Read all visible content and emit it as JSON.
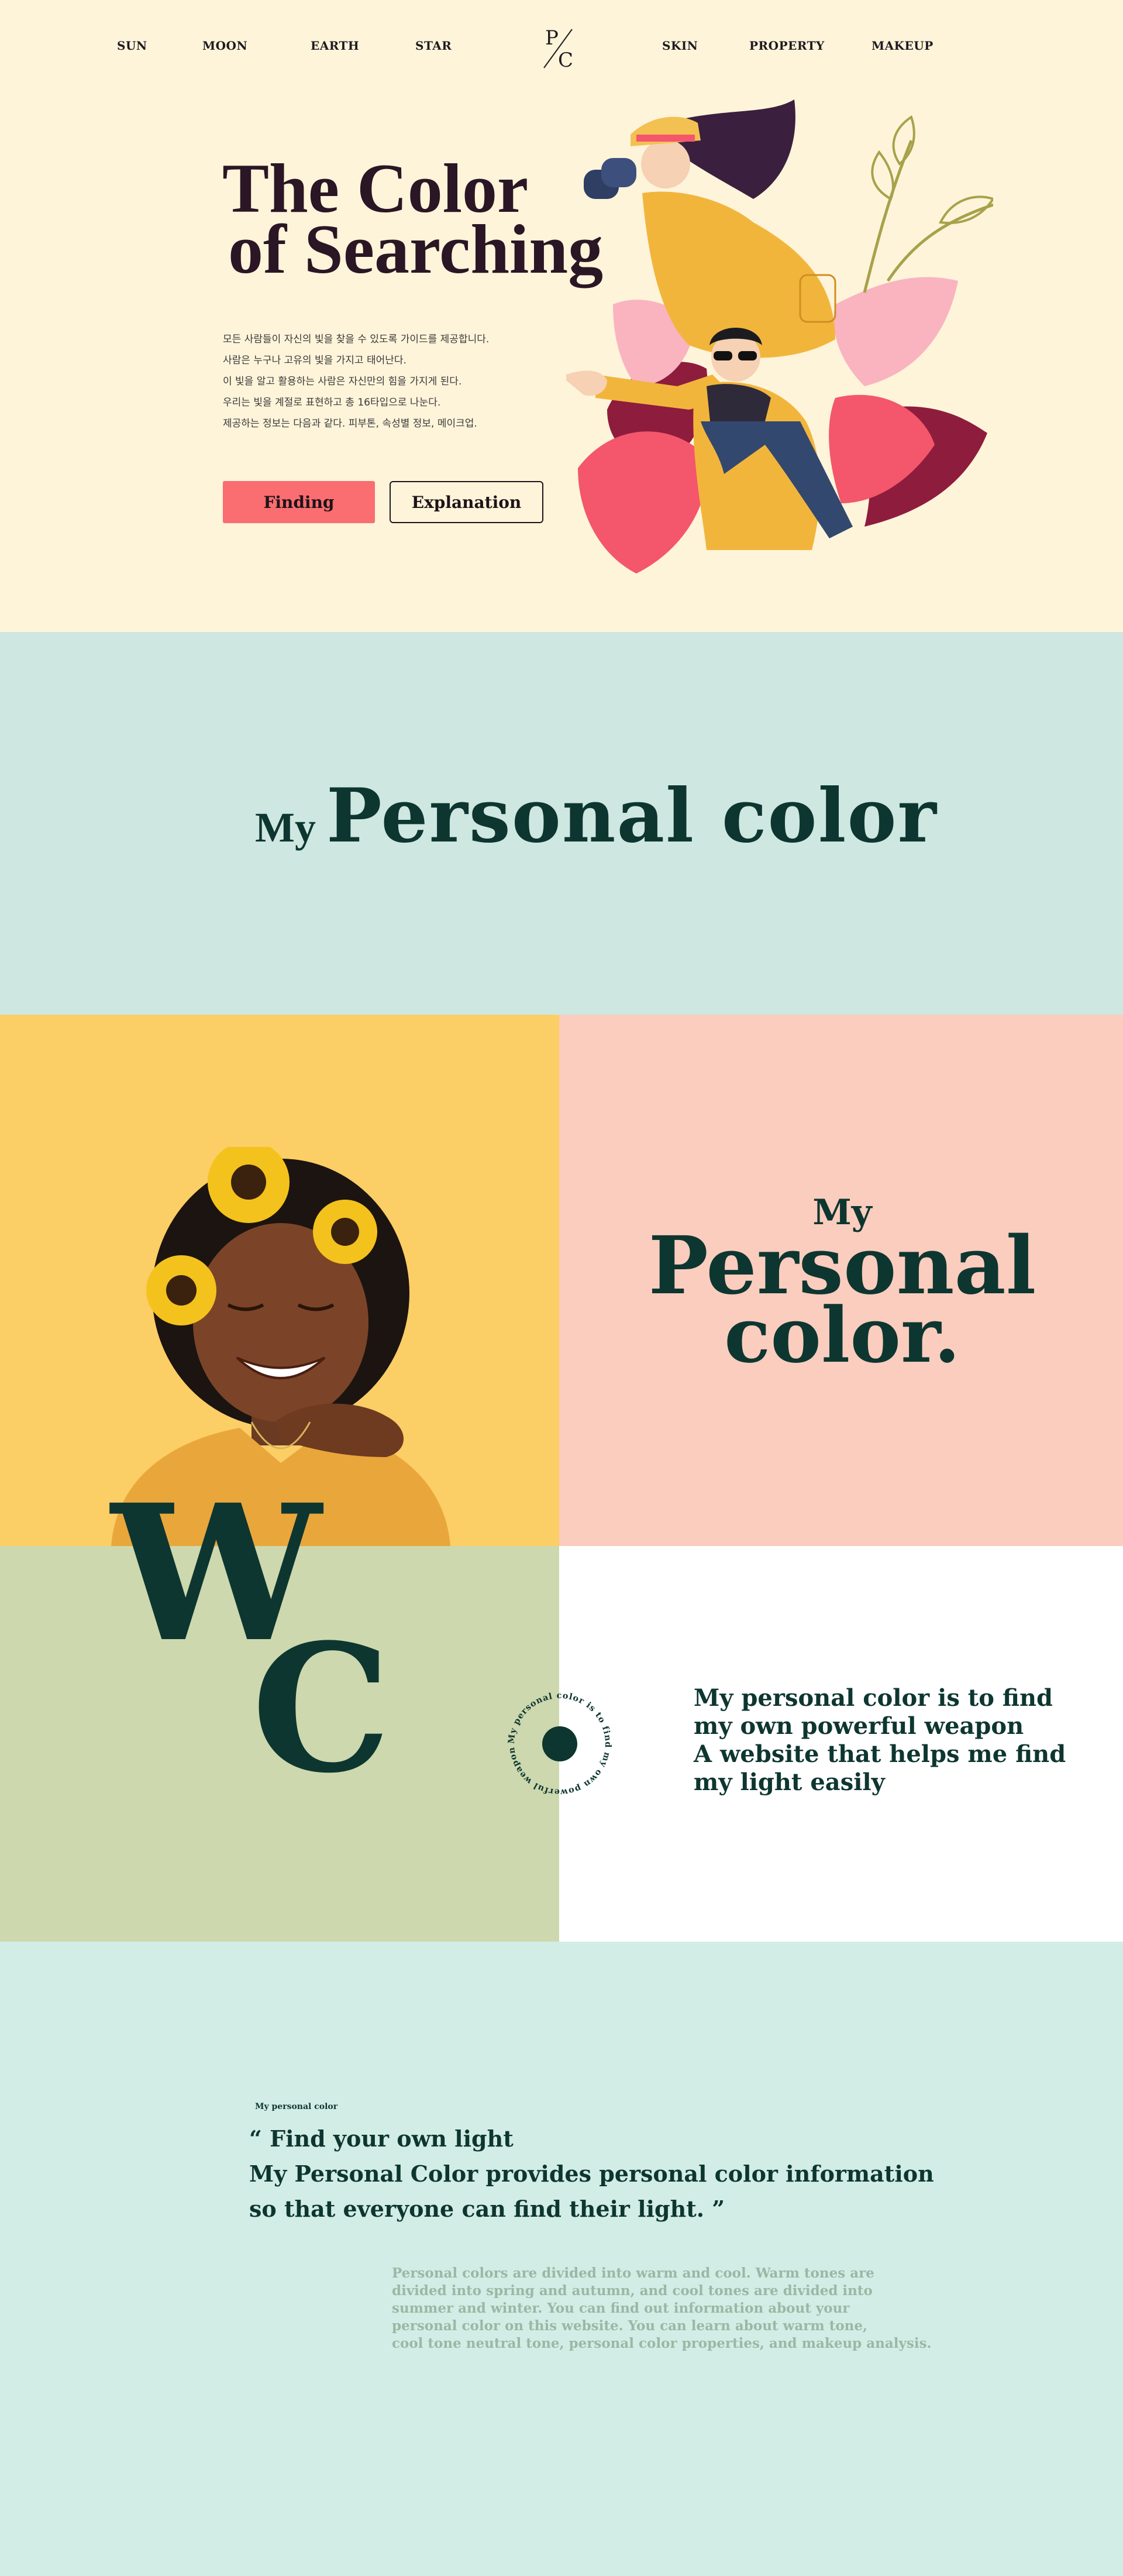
{
  "nav": {
    "left": [
      "SUN",
      "MOON",
      "EARTH",
      "STAR"
    ],
    "right": [
      "SKIN",
      "PROPERTY",
      "MAKEUP"
    ],
    "logo_top": "P",
    "logo_bottom": "C"
  },
  "hero": {
    "title_line1": "The Color",
    "title_line2": "of Searching",
    "description": [
      "모든 사람들이 자신의 빛을 찾을 수 있도록 가이드를 제공합니다.",
      "사람은 누구나 고유의 빛을 가지고 태어난다.",
      "이 빛을 알고 활용하는 사람은 자신만의 힘을 가지게 된다.",
      "우리는 빛을 계절로 표현하고 총 16타입으로 나눈다.",
      "제공하는 정보는 다음과 같다. 피부톤, 속성별 정보, 메이크업."
    ],
    "button_primary": "Finding",
    "button_secondary": "Explanation"
  },
  "banner": {
    "my": "My",
    "title": "Personal color"
  },
  "pink_block": {
    "my": "My",
    "line2": "Personal",
    "line3": "color."
  },
  "monogram": {
    "w": "W",
    "c": "C"
  },
  "badge": {
    "circular_text": "My personal color is to find my own powerful weapon"
  },
  "mission": {
    "lines": [
      "My personal color is to find",
      "my own powerful weapon",
      "A website that helps me find",
      "my light easily"
    ]
  },
  "quote_section": {
    "label": "My personal color",
    "quote_lines": [
      "“ Find your own light",
      "My Personal Color provides personal color information",
      "so that everyone can find their light. ”"
    ],
    "paragraph": [
      "Personal colors are divided into warm and cool. Warm tones are",
      "divided into spring and autumn, and cool tones are divided into",
      "summer and winter. You can find out information about your",
      "personal color on this website. You can learn about warm tone,",
      "cool tone neutral tone, personal color properties, and makeup analysis."
    ]
  },
  "colors": {
    "cream": "#FEF4DA",
    "coral": "#FA6D70",
    "mint": "#CEE7E1",
    "mustard": "#FCCE66",
    "blush": "#FBCDBE",
    "sage": "#CDD8AE",
    "deep_green": "#0E3630"
  }
}
